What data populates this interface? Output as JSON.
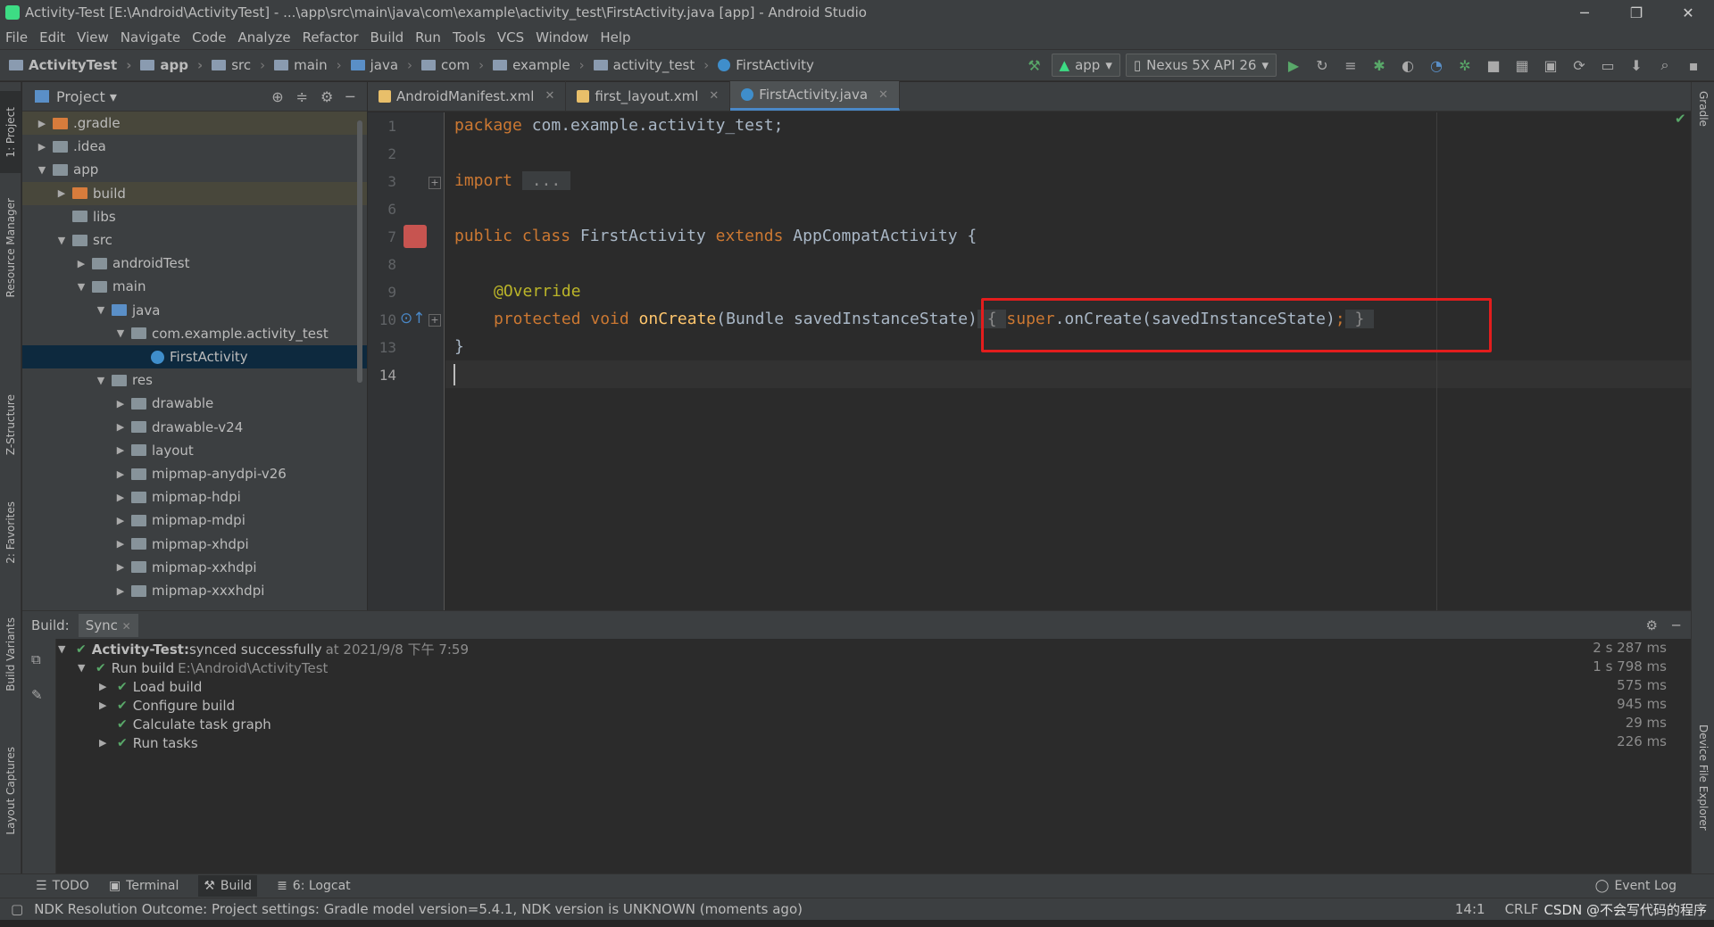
{
  "window": {
    "title": "Activity-Test [E:\\Android\\ActivityTest] - ...\\app\\src\\main\\java\\com\\example\\activity_test\\FirstActivity.java [app] - Android Studio",
    "minimize": "─",
    "restore": "❐",
    "close": "✕"
  },
  "menu": [
    "File",
    "Edit",
    "View",
    "Navigate",
    "Code",
    "Analyze",
    "Refactor",
    "Build",
    "Run",
    "Tools",
    "VCS",
    "Window",
    "Help"
  ],
  "breadcrumbs": [
    "ActivityTest",
    "app",
    "src",
    "main",
    "java",
    "com",
    "example",
    "activity_test",
    "FirstActivity"
  ],
  "toolbar": {
    "run_config": "app",
    "device": "Nexus 5X API 26"
  },
  "left_stripe": [
    "1: Project",
    "Resource Manager",
    "Z-Structure",
    "2: Favorites",
    "Build Variants",
    "Layout Captures"
  ],
  "right_stripe": [
    "Gradle",
    "Device File Explorer"
  ],
  "project_panel": {
    "title": "Project",
    "tree": [
      {
        "label": ".gradle",
        "depth": 1,
        "arrow": "▶",
        "icon": "orange",
        "state": "hl"
      },
      {
        "label": ".idea",
        "depth": 1,
        "arrow": "▶",
        "icon": "grey",
        "state": ""
      },
      {
        "label": "app",
        "depth": 1,
        "arrow": "▼",
        "icon": "grey",
        "state": ""
      },
      {
        "label": "build",
        "depth": 2,
        "arrow": "▶",
        "icon": "orange",
        "state": "hl"
      },
      {
        "label": "libs",
        "depth": 2,
        "arrow": "",
        "icon": "grey",
        "state": ""
      },
      {
        "label": "src",
        "depth": 2,
        "arrow": "▼",
        "icon": "grey",
        "state": ""
      },
      {
        "label": "androidTest",
        "depth": 3,
        "arrow": "▶",
        "icon": "grey",
        "state": ""
      },
      {
        "label": "main",
        "depth": 3,
        "arrow": "▼",
        "icon": "grey",
        "state": ""
      },
      {
        "label": "java",
        "depth": 4,
        "arrow": "▼",
        "icon": "blue",
        "state": ""
      },
      {
        "label": "com.example.activity_test",
        "depth": 5,
        "arrow": "▼",
        "icon": "grey",
        "state": ""
      },
      {
        "label": "FirstActivity",
        "depth": 6,
        "arrow": "",
        "icon": "class",
        "state": "sel"
      },
      {
        "label": "res",
        "depth": 4,
        "arrow": "▼",
        "icon": "grey",
        "state": ""
      },
      {
        "label": "drawable",
        "depth": 5,
        "arrow": "▶",
        "icon": "grey",
        "state": ""
      },
      {
        "label": "drawable-v24",
        "depth": 5,
        "arrow": "▶",
        "icon": "grey",
        "state": ""
      },
      {
        "label": "layout",
        "depth": 5,
        "arrow": "▶",
        "icon": "grey",
        "state": ""
      },
      {
        "label": "mipmap-anydpi-v26",
        "depth": 5,
        "arrow": "▶",
        "icon": "grey",
        "state": ""
      },
      {
        "label": "mipmap-hdpi",
        "depth": 5,
        "arrow": "▶",
        "icon": "grey",
        "state": ""
      },
      {
        "label": "mipmap-mdpi",
        "depth": 5,
        "arrow": "▶",
        "icon": "grey",
        "state": ""
      },
      {
        "label": "mipmap-xhdpi",
        "depth": 5,
        "arrow": "▶",
        "icon": "grey",
        "state": ""
      },
      {
        "label": "mipmap-xxhdpi",
        "depth": 5,
        "arrow": "▶",
        "icon": "grey",
        "state": ""
      },
      {
        "label": "mipmap-xxxhdpi",
        "depth": 5,
        "arrow": "▶",
        "icon": "grey",
        "state": ""
      }
    ]
  },
  "editor_tabs": [
    {
      "label": "AndroidManifest.xml",
      "active": false,
      "color": "#e8bf6a"
    },
    {
      "label": "first_layout.xml",
      "active": false,
      "color": "#e8bf6a"
    },
    {
      "label": "FirstActivity.java",
      "active": true,
      "color": "#3f8ecb"
    }
  ],
  "editor": {
    "line_numbers": [
      "1",
      "2",
      "3",
      "6",
      "7",
      "8",
      "9",
      "10",
      "13",
      "14"
    ],
    "package_kw": "package",
    "package_name": " com.example.activity_test;",
    "import_kw": "import",
    "import_fold": " ... ",
    "class_public": "public class",
    "class_name": " FirstActivity ",
    "class_extends": "extends",
    "class_parent": " AppCompatActivity {",
    "annotation": "@Override",
    "method_mods": "protected void",
    "method_name": " onCreate",
    "method_params": "(Bundle savedInstanceState)",
    "fold_open": " { ",
    "super_kw": "super",
    "super_call": ".onCreate(savedInstanceState)",
    "semicolon": ";",
    "fold_close": " } ",
    "closing_brace": "}"
  },
  "build": {
    "label": "Build:",
    "tab": "Sync",
    "rows": [
      {
        "bold": "Activity-Test:",
        "text": " synced successfully",
        "dim": "at 2021/9/8 下午 7:59",
        "time": "2 s 287 ms"
      },
      {
        "bold": "",
        "text": "Run build",
        "dim": "E:\\Android\\ActivityTest",
        "time": "1 s 798 ms"
      },
      {
        "bold": "",
        "text": "Load build",
        "dim": "",
        "time": "575 ms"
      },
      {
        "bold": "",
        "text": "Configure build",
        "dim": "",
        "time": "945 ms"
      },
      {
        "bold": "",
        "text": "Calculate task graph",
        "dim": "",
        "time": "29 ms"
      },
      {
        "bold": "",
        "text": "Run tasks",
        "dim": "",
        "time": "226 ms"
      }
    ]
  },
  "bottom_tabs": [
    "TODO",
    "Terminal",
    "Build",
    "6: Logcat"
  ],
  "event_log": "Event Log",
  "status": {
    "message": "NDK Resolution Outcome: Project settings: Gradle model version=5.4.1, NDK version is UNKNOWN (moments ago)",
    "position": "14:1",
    "line_sep": "CRLF",
    "watermark": "CSDN @不会写代码的程序"
  }
}
